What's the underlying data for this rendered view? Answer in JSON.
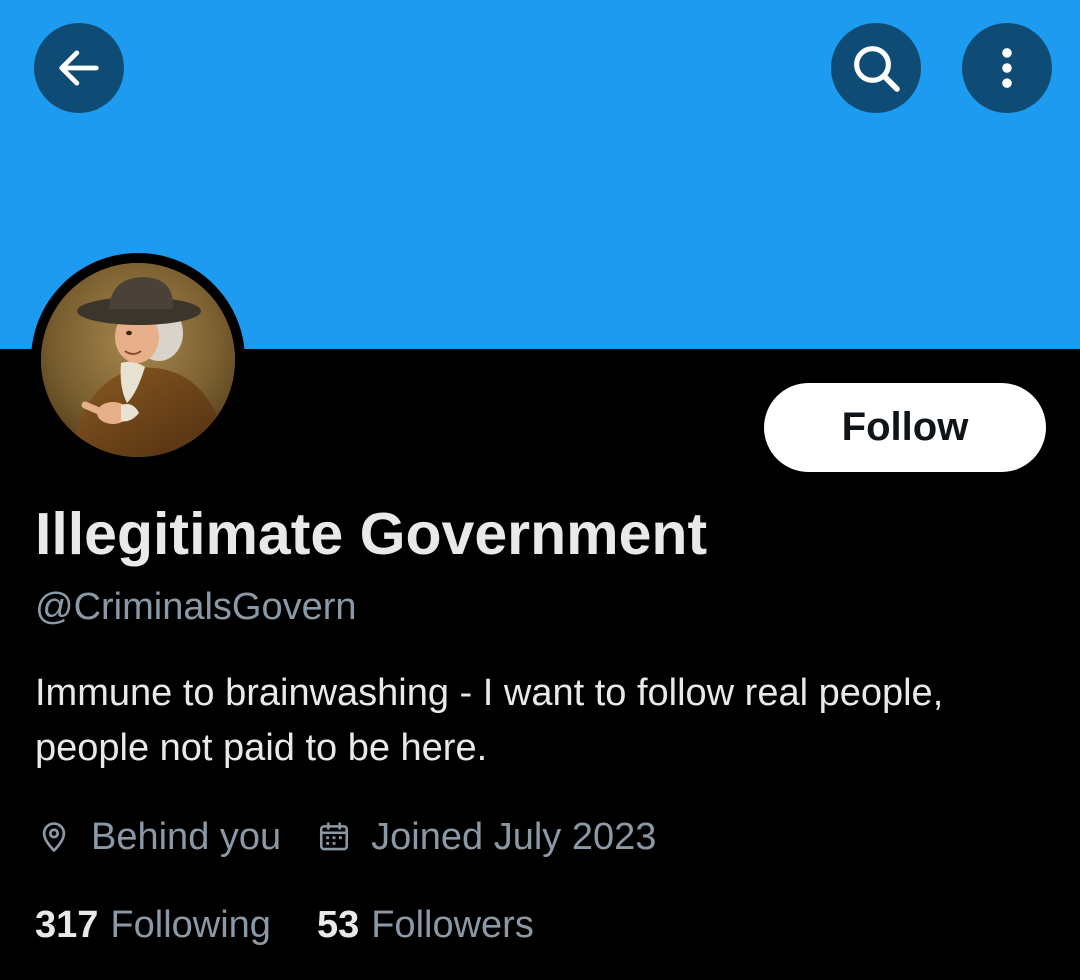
{
  "header": {
    "banner_color": "#1d9bf0",
    "back_icon": "arrow-left-icon",
    "search_icon": "search-icon",
    "more_icon": "more-vertical-icon"
  },
  "profile": {
    "display_name": "Illegitimate Government",
    "handle": "@CriminalsGovern",
    "bio": "Immune to brainwashing - I want to follow real people, people not paid to be here.",
    "location": "Behind you",
    "joined": "Joined July 2023",
    "avatar": "painting-portrait-avatar"
  },
  "actions": {
    "follow_label": "Follow"
  },
  "stats": {
    "following_count": "317",
    "following_label": "Following",
    "followers_count": "53",
    "followers_label": "Followers"
  },
  "colors": {
    "background": "#000000",
    "primary_text": "#e7e9ea",
    "secondary_text": "#8b98a5",
    "button_overlay": "#0f4c75"
  }
}
